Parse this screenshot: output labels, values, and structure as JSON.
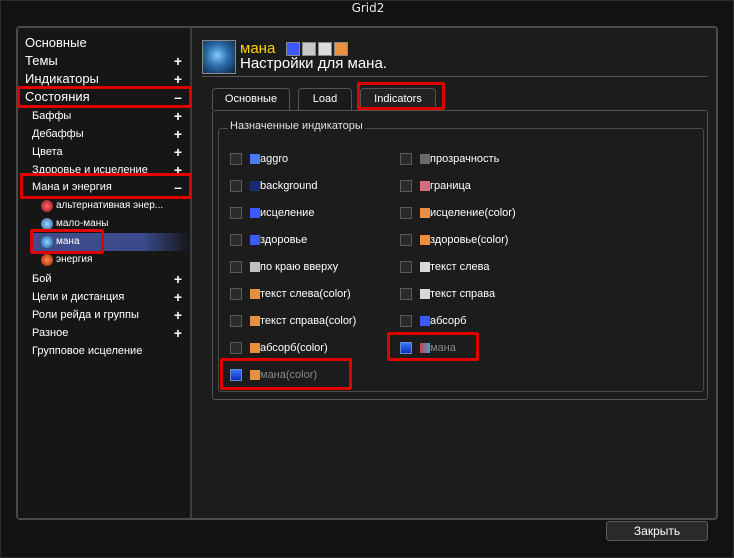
{
  "window": {
    "title": "Grid2"
  },
  "tree": {
    "items": [
      {
        "label": "Основные",
        "level": 0,
        "toggle": ""
      },
      {
        "label": "Темы",
        "level": 0,
        "toggle": "+"
      },
      {
        "label": "Индикаторы",
        "level": 0,
        "toggle": "+"
      },
      {
        "label": "Состояния",
        "level": 0,
        "toggle": "–"
      },
      {
        "label": "Баффы",
        "level": 1,
        "toggle": "+"
      },
      {
        "label": "Дебаффы",
        "level": 1,
        "toggle": "+"
      },
      {
        "label": "Цвета",
        "level": 1,
        "toggle": "+"
      },
      {
        "label": "Здоровье и исцеление",
        "level": 1,
        "toggle": "+"
      },
      {
        "label": "Мана и энергия",
        "level": 1,
        "toggle": "–"
      },
      {
        "label": "альтернативная энер...",
        "level": 2,
        "toggle": ""
      },
      {
        "label": "мало-маны",
        "level": 2,
        "toggle": ""
      },
      {
        "label": "мана",
        "level": 2,
        "toggle": ""
      },
      {
        "label": "энергия",
        "level": 2,
        "toggle": ""
      },
      {
        "label": "Бой",
        "level": 1,
        "toggle": "+"
      },
      {
        "label": "Цели и дистанция",
        "level": 1,
        "toggle": "+"
      },
      {
        "label": "Роли рейда и группы",
        "level": 1,
        "toggle": "+"
      },
      {
        "label": "Разное",
        "level": 1,
        "toggle": "+"
      },
      {
        "label": "Групповое исцеление",
        "level": 1,
        "toggle": ""
      }
    ]
  },
  "header": {
    "status_name": "мана",
    "subtitle": "Настройки для мана."
  },
  "tabs": [
    {
      "label": "Основные"
    },
    {
      "label": "Load"
    },
    {
      "label": "Indicators"
    }
  ],
  "indicators": {
    "title": "Назначенные индикаторы",
    "left": [
      {
        "label": "aggro",
        "checked": false
      },
      {
        "label": "background",
        "checked": false
      },
      {
        "label": "исцеление",
        "checked": false
      },
      {
        "label": "здоровье",
        "checked": false
      },
      {
        "label": "по краю вверху",
        "checked": false
      },
      {
        "label": "текст слева(color)",
        "checked": false
      },
      {
        "label": "текст справа(color)",
        "checked": false
      },
      {
        "label": "абсорб(color)",
        "checked": false
      },
      {
        "label": "мана(color)",
        "checked": true
      }
    ],
    "right": [
      {
        "label": "прозрачность",
        "checked": false
      },
      {
        "label": "граница",
        "checked": false
      },
      {
        "label": "исцеление(color)",
        "checked": false
      },
      {
        "label": "здоровье(color)",
        "checked": false
      },
      {
        "label": "текст слева",
        "checked": false
      },
      {
        "label": "текст справа",
        "checked": false
      },
      {
        "label": "абсорб",
        "checked": false
      },
      {
        "label": "мана",
        "checked": true
      }
    ]
  },
  "footer": {
    "close_label": "Закрыть"
  },
  "colors": {
    "highlight": "#e00000",
    "accent": "#ffd200",
    "selection": "#3a4a8c"
  }
}
